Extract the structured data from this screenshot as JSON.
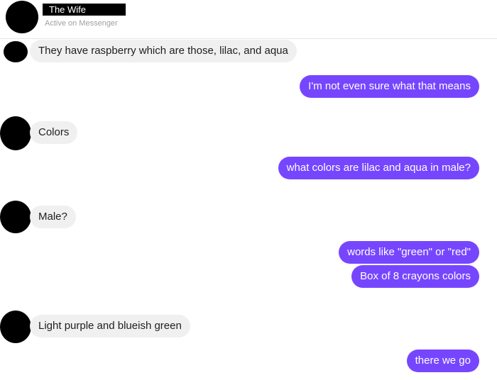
{
  "header": {
    "contact_name": "The Wife",
    "status": "Active on Messenger"
  },
  "messages": [
    {
      "direction": "incoming",
      "text": "They have raspberry which are those, lilac, and aqua"
    },
    {
      "direction": "outgoing",
      "text": "I'm not even sure what that means"
    },
    {
      "direction": "incoming",
      "text": "Colors"
    },
    {
      "direction": "outgoing",
      "text": "what colors are lilac and aqua in male?"
    },
    {
      "direction": "incoming",
      "text": "Male?"
    },
    {
      "direction": "outgoing",
      "text": "words like \"green\" or \"red\""
    },
    {
      "direction": "outgoing",
      "text": "Box of 8 crayons colors"
    },
    {
      "direction": "incoming",
      "text": "Light purple and blueish green"
    },
    {
      "direction": "outgoing",
      "text": "there we go"
    }
  ],
  "colors": {
    "outgoing_bubble": "#7646ff",
    "incoming_bubble": "#f1f0f0",
    "outgoing_text": "#ffffff",
    "incoming_text": "#1c1e21"
  }
}
